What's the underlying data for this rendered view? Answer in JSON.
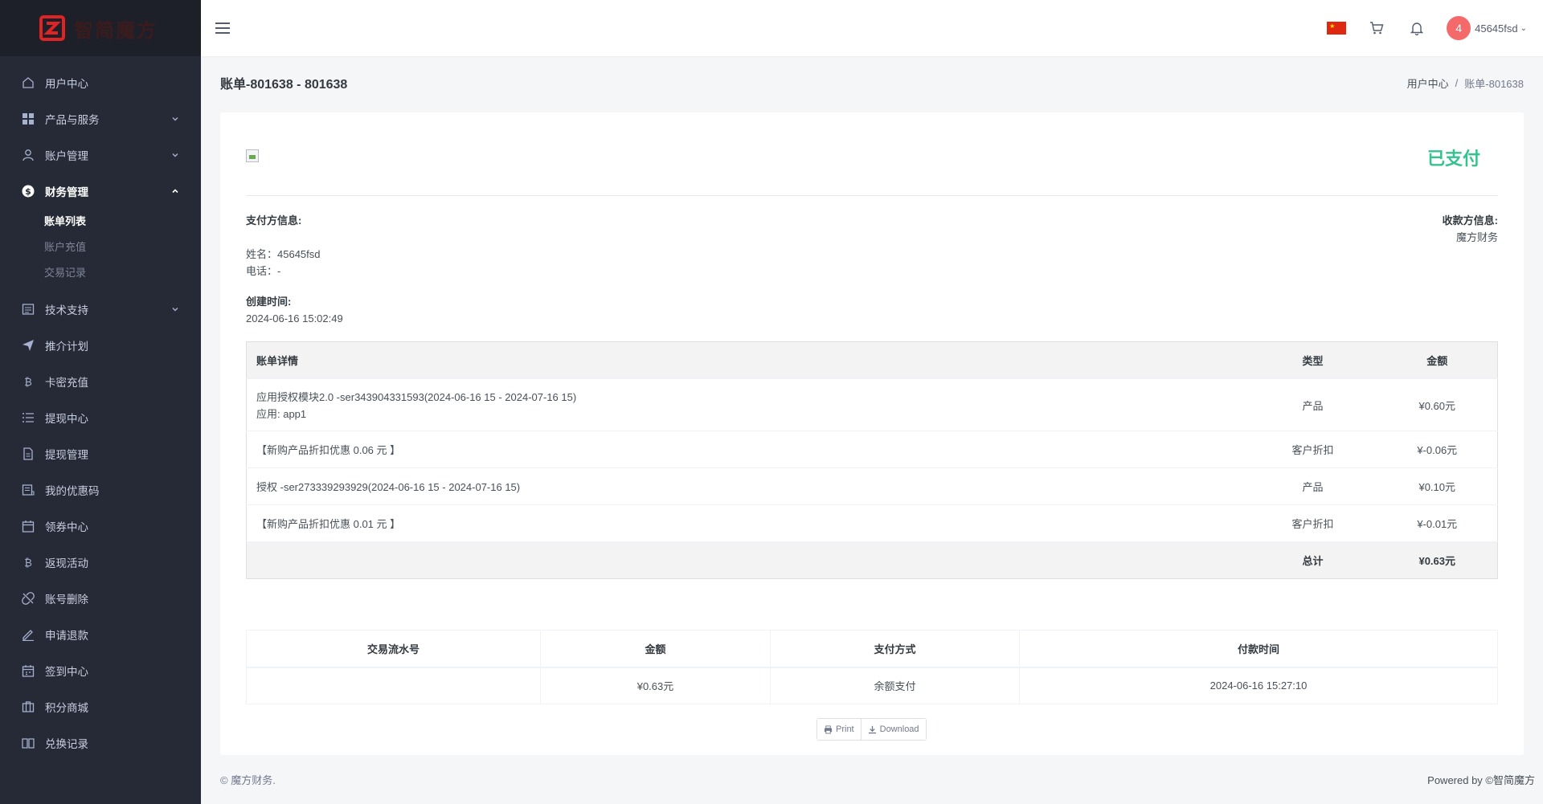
{
  "brand": {
    "name": "智简魔方"
  },
  "sidebar": {
    "items": [
      {
        "label": "用户中心",
        "icon": "home-icon"
      },
      {
        "label": "产品与服务",
        "icon": "grid-icon",
        "has_chevron": true
      },
      {
        "label": "账户管理",
        "icon": "user-icon",
        "has_chevron": true
      },
      {
        "label": "财务管理",
        "icon": "dollar-circle-icon",
        "has_chevron": true,
        "expanded": true
      },
      {
        "label": "技术支持",
        "icon": "ticket-icon",
        "has_chevron": true
      },
      {
        "label": "推介计划",
        "icon": "send-icon"
      },
      {
        "label": "卡密充值",
        "icon": "bitcoin-icon"
      },
      {
        "label": "提现中心",
        "icon": "list-icon"
      },
      {
        "label": "提现管理",
        "icon": "file-icon"
      },
      {
        "label": "我的优惠码",
        "icon": "coupon-icon"
      },
      {
        "label": "领券中心",
        "icon": "calendar-icon"
      },
      {
        "label": "返现活动",
        "icon": "bitcoin-icon"
      },
      {
        "label": "账号删除",
        "icon": "unlink-icon"
      },
      {
        "label": "申请退款",
        "icon": "pen-icon"
      },
      {
        "label": "签到中心",
        "icon": "calendar-check-icon"
      },
      {
        "label": "积分商城",
        "icon": "briefcase-icon"
      },
      {
        "label": "兑换记录",
        "icon": "book-icon"
      }
    ],
    "finance_sub": [
      {
        "label": "账单列表",
        "active": true
      },
      {
        "label": "账户充值"
      },
      {
        "label": "交易记录"
      }
    ]
  },
  "topbar": {
    "notification_count": "4",
    "username": "45645fsd",
    "caret": "⌄"
  },
  "page": {
    "title": "账单-801638 - 801638",
    "breadcrumb": [
      "用户中心",
      "账单-801638"
    ],
    "breadcrumb_sep": "/"
  },
  "invoice": {
    "status": "已支付",
    "status_color": "#34c38f",
    "payer_label": "支付方信息:",
    "payer_name": "姓名：45645fsd",
    "payer_phone": "电话：-",
    "created_label": "创建时间:",
    "created_time": "2024-06-16 15:02:49",
    "payee_label": "收款方信息:",
    "payee_name": "魔方财务",
    "table_headers": [
      "账单详情",
      "类型",
      "金额"
    ],
    "rows": [
      {
        "desc": "应用授权模块2.0 -ser343904331593(2024-06-16 15 - 2024-07-16 15)",
        "desc2": "应用: app1",
        "type": "产品",
        "amount": "¥0.60元"
      },
      {
        "desc": "【新购产品折扣优惠 0.06 元 】",
        "type": "客户折扣",
        "amount": "¥-0.06元"
      },
      {
        "desc": "授权 -ser273339293929(2024-06-16 15 - 2024-07-16 15)",
        "type": "产品",
        "amount": "¥0.10元"
      },
      {
        "desc": "【新购产品折扣优惠 0.01 元 】",
        "type": "客户折扣",
        "amount": "¥-0.01元"
      }
    ],
    "total_label": "总计",
    "total_amount": "¥0.63元"
  },
  "payments": {
    "headers": [
      "交易流水号",
      "金额",
      "支付方式",
      "付款时间"
    ],
    "rows": [
      {
        "txn": "",
        "amount": "¥0.63元",
        "method": "余额支付",
        "time": "2024-06-16 15:27:10"
      }
    ]
  },
  "actions": {
    "print": "Print",
    "download": "Download"
  },
  "footer": {
    "left": "© 魔方财务.",
    "right": "Powered by ©智简魔方"
  }
}
